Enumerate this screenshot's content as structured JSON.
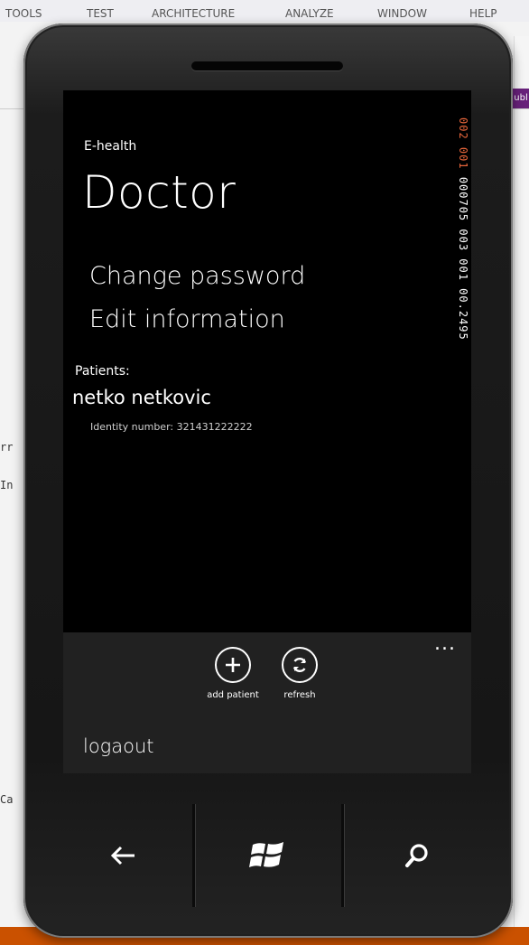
{
  "ide": {
    "menu": [
      "TOOLS",
      "TEST",
      "ARCHITECTURE",
      "ANALYZE",
      "WINDOW",
      "HELP"
    ],
    "tab_fragment": "ubl",
    "code_fragments": [
      "rr",
      "In",
      "Ca"
    ]
  },
  "app": {
    "subtitle": "E-health",
    "page_title": "Doctor",
    "links": [
      "Change password",
      "Edit information"
    ],
    "patients_label": "Patients:",
    "patients": [
      {
        "name": "netko netkovic",
        "identity": "Identity number: 321431222222"
      }
    ]
  },
  "frame_counter": {
    "red": "002 001",
    "white": "000705 003 001 00.2495"
  },
  "appbar": {
    "ellipsis": "...",
    "buttons": [
      {
        "label": "add patient",
        "icon": "plus-icon"
      },
      {
        "label": "refresh",
        "icon": "refresh-icon"
      }
    ],
    "menu_item": "logaout"
  },
  "hardware": {
    "buttons": [
      "back-arrow-icon",
      "windows-logo-icon",
      "search-icon"
    ]
  }
}
